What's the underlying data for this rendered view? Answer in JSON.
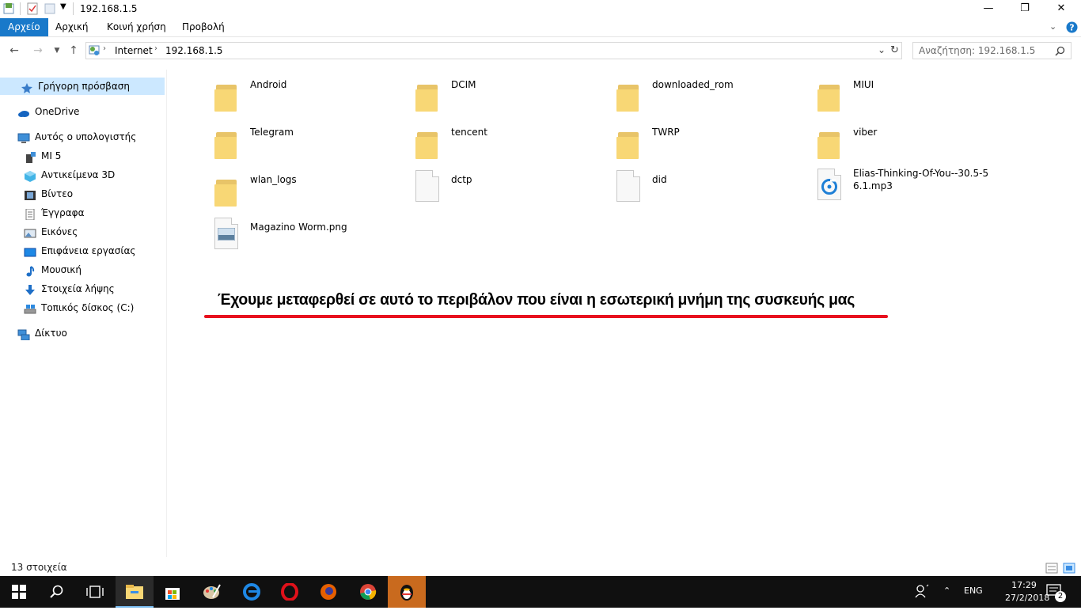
{
  "window": {
    "title": "192.168.1.5",
    "minimize": "—",
    "maximize": "❐",
    "close": "✕"
  },
  "ribbon": {
    "tabs": [
      "Αρχείο",
      "Αρχική",
      "Κοινή χρήση",
      "Προβολή"
    ]
  },
  "address": {
    "segments": [
      "Internet",
      "192.168.1.5"
    ],
    "separator": "›"
  },
  "search": {
    "placeholder": "Αναζήτηση: 192.168.1.5"
  },
  "sidebar": {
    "items": [
      {
        "label": "Γρήγορη πρόσβαση",
        "icon": "star-icon"
      },
      {
        "label": "OneDrive",
        "icon": "cloud-icon"
      },
      {
        "label": "Αυτός ο υπολογιστής",
        "icon": "computer-icon"
      },
      {
        "label": "MI 5",
        "icon": "phone-icon"
      },
      {
        "label": "Αντικείμενα 3D",
        "icon": "cube-icon"
      },
      {
        "label": "Βίντεο",
        "icon": "film-icon"
      },
      {
        "label": "Έγγραφα",
        "icon": "document-icon"
      },
      {
        "label": "Εικόνες",
        "icon": "picture-icon"
      },
      {
        "label": "Επιφάνεια εργασίας",
        "icon": "desktop-icon"
      },
      {
        "label": "Μουσική",
        "icon": "music-note-icon"
      },
      {
        "label": "Στοιχεία λήψης",
        "icon": "download-arrow-icon"
      },
      {
        "label": "Τοπικός δίσκος (C:)",
        "icon": "drive-icon"
      },
      {
        "label": "Δίκτυο",
        "icon": "network-icon"
      }
    ]
  },
  "files": [
    {
      "name": "Android",
      "type": "folder"
    },
    {
      "name": "DCIM",
      "type": "folder"
    },
    {
      "name": "downloaded_rom",
      "type": "folder"
    },
    {
      "name": "MIUI",
      "type": "folder"
    },
    {
      "name": "Telegram",
      "type": "folder"
    },
    {
      "name": "tencent",
      "type": "folder"
    },
    {
      "name": "TWRP",
      "type": "folder"
    },
    {
      "name": "viber",
      "type": "folder"
    },
    {
      "name": "wlan_logs",
      "type": "folder"
    },
    {
      "name": "dctp",
      "type": "file"
    },
    {
      "name": "did",
      "type": "file"
    },
    {
      "name": "Elias-Thinking-Of-You--30.5-56.1.mp3",
      "type": "audio"
    },
    {
      "name": "Magazino Worm.png",
      "type": "image"
    }
  ],
  "annotation": {
    "text": "Έχουμε μεταφερθεί σε αυτό το περιβάλον που είναι η εσωτερική μνήμη της συσκευής μας"
  },
  "status": {
    "count": "13 στοιχεία"
  },
  "taskbar": {
    "language": "ENG",
    "time": "17:29",
    "date": "27/2/2018",
    "notifications": "2",
    "apps": [
      "start-icon",
      "search-icon",
      "task-view-icon",
      "file-explorer-icon",
      "store-icon",
      "paint-icon",
      "edge-icon",
      "opera-icon",
      "firefox-icon",
      "chrome-icon",
      "qq-penguin-icon"
    ]
  },
  "colors": {
    "accent": "#1979ca",
    "selection": "#cce8ff",
    "folder": "#f8d775",
    "annotation_underline": "#e8111e",
    "taskbar": "#101010"
  }
}
